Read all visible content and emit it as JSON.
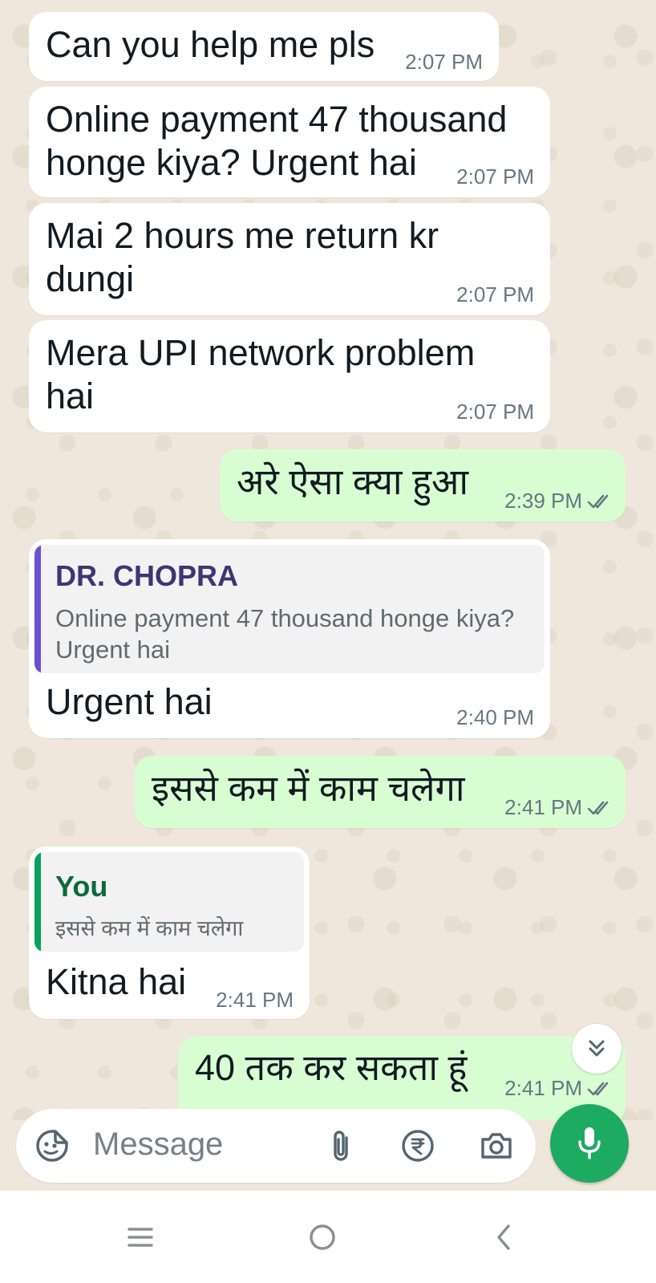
{
  "messages": [
    {
      "direction": "incoming",
      "text": "Can you help me pls",
      "time": "2:07 PM"
    },
    {
      "direction": "incoming",
      "text": "Online payment 47 thousand\nhonge kiya? Urgent hai",
      "time": "2:07 PM"
    },
    {
      "direction": "incoming",
      "text": "Mai 2 hours me return kr\ndungi",
      "time": "2:07 PM"
    },
    {
      "direction": "incoming",
      "text": "Mera UPI network problem\nhai",
      "time": "2:07 PM"
    },
    {
      "direction": "outgoing",
      "text": "अरे ऐसा क्या हुआ",
      "time": "2:39 PM",
      "status": "read"
    },
    {
      "direction": "incoming",
      "reply_to": {
        "author": "DR. CHOPRA",
        "text": "Online payment 47 thousand honge kiya?\nUrgent hai",
        "accent": "#6c4fd6"
      },
      "text": "Urgent hai",
      "time": "2:40 PM"
    },
    {
      "direction": "outgoing",
      "text": "इससे कम में काम चलेगा",
      "time": "2:41 PM",
      "status": "read"
    },
    {
      "direction": "incoming",
      "reply_to": {
        "author": "You",
        "text": "इससे कम में काम चलेगा",
        "accent": "#06a35a"
      },
      "text": "Kitna hai",
      "time": "2:41 PM"
    },
    {
      "direction": "outgoing",
      "text": "40 तक कर सकता हूं",
      "time": "2:41 PM",
      "status": "read"
    }
  ],
  "scroll_down": {
    "icon": "double-chevron-down-icon"
  },
  "composer": {
    "placeholder": "Message",
    "icons": [
      "sticker-icon",
      "attach-icon",
      "rupee-payment-icon",
      "camera-icon"
    ]
  },
  "mic_button": {
    "icon": "mic-icon",
    "color": "#1daa61"
  },
  "nav_bar": {
    "icons": [
      "menu-icon",
      "home-icon",
      "back-icon"
    ]
  },
  "colors": {
    "incoming_bubble": "#ffffff",
    "outgoing_bubble": "#d9fdd3",
    "background": "#efe7dc",
    "tick_read": "#667781",
    "reply_accent_other": "#6c4fd6",
    "reply_accent_you": "#06a35a"
  }
}
